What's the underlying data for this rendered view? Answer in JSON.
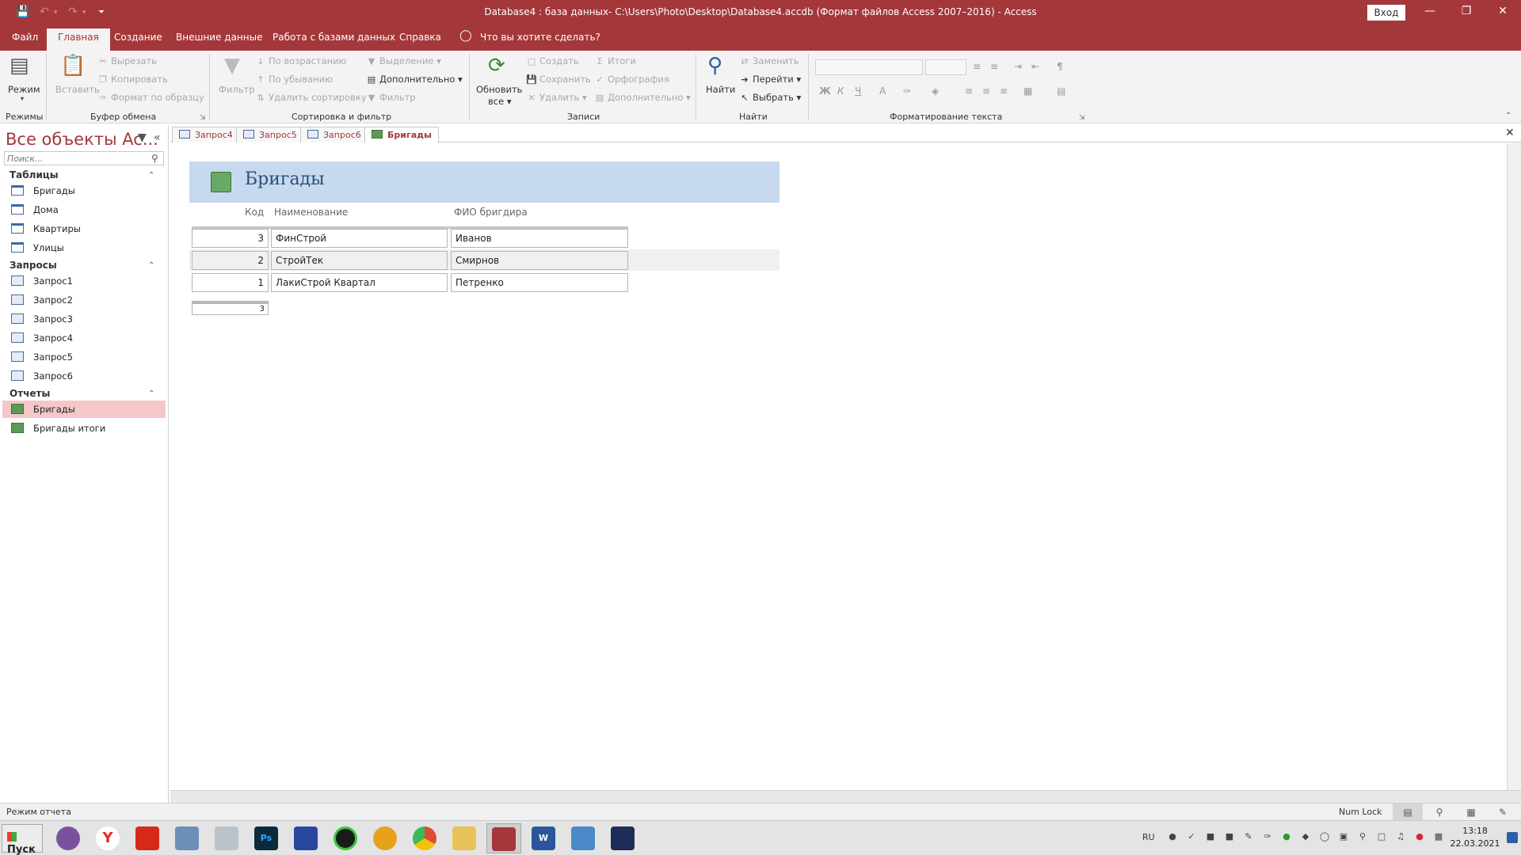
{
  "window": {
    "title": "Database4 : база данных- C:\\Users\\Photo\\Desktop\\Database4.accdb (Формат файлов Access 2007–2016)  -  Access",
    "login_label": "Вход",
    "minimize_glyph": "—",
    "restore_glyph": "❐",
    "close_glyph": "✕"
  },
  "quick_access": {
    "save_icon": "save-icon",
    "undo_icon": "undo-icon",
    "redo_icon": "redo-icon",
    "customize_icon": "customize-icon"
  },
  "menu": {
    "tabs": [
      "Файл",
      "Главная",
      "Создание",
      "Внешние данные",
      "Работа с базами данных",
      "Справка"
    ],
    "active_tab": "Главная",
    "tell_me": "Что вы хотите сделать?"
  },
  "ribbon": {
    "groups": {
      "modes": "Режимы",
      "clipboard": "Буфер обмена",
      "sort_filter": "Сортировка и фильтр",
      "records": "Записи",
      "find": "Найти",
      "text_format": "Форматирование текста"
    },
    "buttons": {
      "mode": "Режим",
      "paste": "Вставить",
      "cut": "Вырезать",
      "copy": "Копировать",
      "format_painter": "Формат по образцу",
      "filter": "Фильтр",
      "sort_asc": "По возрастанию",
      "sort_desc": "По убыванию",
      "remove_sort": "Удалить сортировку",
      "selection": "Выделение",
      "advanced": "Дополнительно",
      "toggle_filter": "Фильтр",
      "refresh_all_1": "Обновить",
      "refresh_all_2": "все",
      "new": "Создать",
      "save": "Сохранить",
      "delete": "Удалить",
      "totals": "Итоги",
      "spelling": "Орфография",
      "more": "Дополнительно",
      "find": "Найти",
      "replace": "Заменить",
      "goto": "Перейти",
      "select": "Выбрать"
    },
    "format_buttons": {
      "bold": "Ж",
      "italic": "К",
      "underline": "Ч",
      "font_color": "А"
    }
  },
  "nav": {
    "title": "Все объекты Ac...",
    "search_placeholder": "Поиск...",
    "groups": [
      {
        "label": "Таблицы",
        "items": [
          "Бригады",
          "Дома",
          "Квартиры",
          "Улицы"
        ]
      },
      {
        "label": "Запросы",
        "items": [
          "Запрос1",
          "Запрос2",
          "Запрос3",
          "Запрос4",
          "Запрос5",
          "Запрос6"
        ]
      },
      {
        "label": "Отчеты",
        "items": [
          "Бригады",
          "Бригады итоги"
        ]
      }
    ],
    "selected": "Бригады"
  },
  "doc_tabs": [
    "Запрос4",
    "Запрос5",
    "Запрос6",
    "Бригады"
  ],
  "doc_tab_active": "Бригады",
  "report": {
    "title": "Бригады",
    "columns": [
      "Код",
      "Наименование",
      "ФИО бригдира"
    ],
    "rows": [
      {
        "code": "3",
        "name": "ФинСтрой",
        "foreman": "Иванов"
      },
      {
        "code": "2",
        "name": "СтройТек",
        "foreman": "Смирнов"
      },
      {
        "code": "1",
        "name": "ЛакиСтрой Квартал",
        "foreman": "Петренко"
      }
    ],
    "total": "3"
  },
  "status": {
    "mode_text": "Режим отчета",
    "numlock": "Num Lock"
  },
  "taskbar": {
    "start_label": "Пуск",
    "apps": [
      {
        "name": "viber",
        "label": "",
        "color": "#7b519d"
      },
      {
        "name": "yandex",
        "label": "Y",
        "color": "#ffffff"
      },
      {
        "name": "acrobat",
        "label": "",
        "color": "#d6291a"
      },
      {
        "name": "calculator",
        "label": "",
        "color": "#6c8fb8"
      },
      {
        "name": "jar-app",
        "label": "",
        "color": "#b9c3cc"
      },
      {
        "name": "photoshop",
        "label": "Ps",
        "color": "#0b2b3c"
      },
      {
        "name": "floppy-app",
        "label": "",
        "color": "#2a47a0"
      },
      {
        "name": "green-app",
        "label": "",
        "color": "#1a1a1a"
      },
      {
        "name": "triangle-app",
        "label": "",
        "color": "#e7a21b"
      },
      {
        "name": "chrome",
        "label": "",
        "color": "#dd4b39"
      },
      {
        "name": "explorer",
        "label": "",
        "color": "#e8c35a"
      },
      {
        "name": "access",
        "label": "",
        "color": "#a4373a"
      },
      {
        "name": "word",
        "label": "W",
        "color": "#2b579a"
      },
      {
        "name": "paint",
        "label": "",
        "color": "#4a88c8"
      },
      {
        "name": "camera-app",
        "label": "",
        "color": "#1d2d59"
      }
    ],
    "lang": "RU",
    "time": "13:18",
    "date": "22.03.2021"
  },
  "colors": {
    "accent": "#a4373a",
    "report_header": "#c7d9ef",
    "nav_selected": "#f6c7c8"
  }
}
